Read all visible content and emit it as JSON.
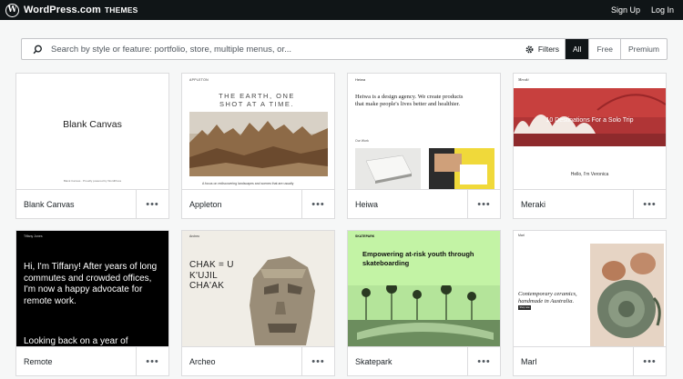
{
  "topbar": {
    "brand": "WordPress.com",
    "brand_sub": "THEMES",
    "logo_letter": "W",
    "signup": "Sign Up",
    "login": "Log In"
  },
  "search": {
    "placeholder": "Search by style or feature: portfolio, store, multiple menus, or...",
    "filters_label": "Filters",
    "segments": [
      "All",
      "Free",
      "Premium"
    ],
    "selected_segment": "All"
  },
  "themes": [
    {
      "name": "Blank Canvas",
      "preview_title": "Blank Canvas",
      "preview_foot": "Blank Canvas · Proudly powered by WordPress"
    },
    {
      "name": "Appleton",
      "preview_brand": "APPLETON",
      "preview_title": "THE EARTH, ONE SHOT AT A TIME.",
      "preview_caption": "A focus on rediscovering landscapes and scenes that are usually"
    },
    {
      "name": "Heiwa",
      "preview_brand": "Heiwa",
      "preview_title": "Heiwa is a design agency. We create products that make people's lives better and healthier.",
      "preview_section": "Our Work"
    },
    {
      "name": "Meraki",
      "preview_brand": "Meraki",
      "preview_title": "10 Destinations For a Solo Trip",
      "preview_sub": "Hello, I'm Veronica"
    },
    {
      "name": "Remote",
      "preview_brand": "Tiffany Jones",
      "preview_title": "Hi, I'm Tiffany! After years of long commutes and crowded offices, I'm now a happy advocate for remote work.",
      "preview_more": "Looking back on a year of"
    },
    {
      "name": "Archeo",
      "preview_brand": "Archeo",
      "preview_title": "CHAK = U K'UJIL CHA'AK"
    },
    {
      "name": "Skatepark",
      "preview_brand": "SKATEPARK",
      "preview_title": "Empowering at-risk youth through skateboarding"
    },
    {
      "name": "Marl",
      "preview_brand": "Marl",
      "preview_title": "Contemporary ceramics, handmade in Australia.",
      "preview_button": "Shop now"
    }
  ],
  "more_glyph": "•••",
  "colors": {
    "topbar": "#101517",
    "skatepark_green": "#c3f3a5",
    "meraki_sky": "#c7403e",
    "archeo_bg": "#f0ede6"
  }
}
